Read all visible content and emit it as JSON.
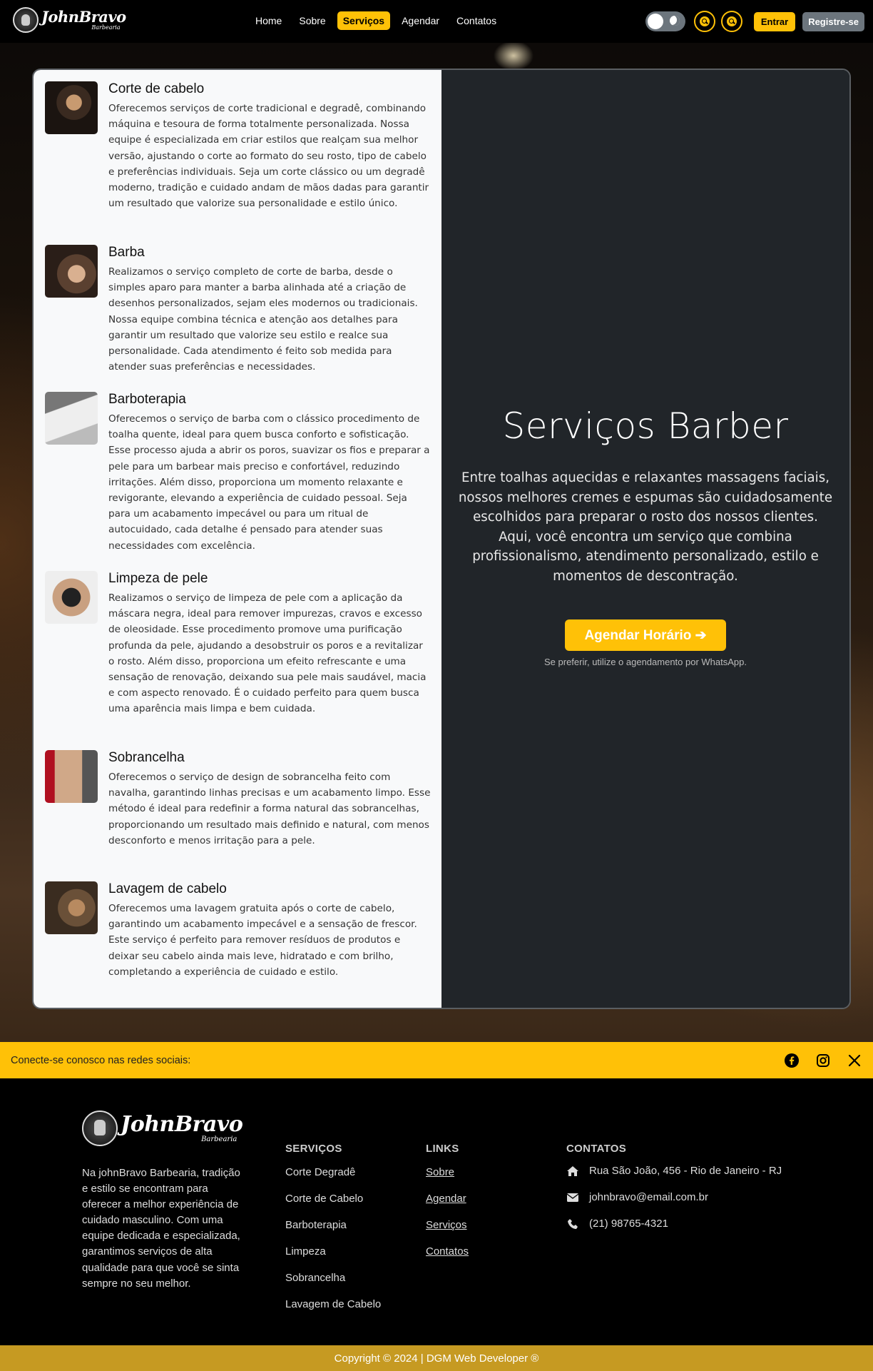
{
  "header": {
    "brand": "JohnBravo",
    "brand_sub": "Barbearia",
    "nav": [
      "Home",
      "Sobre",
      "Serviços",
      "Agendar",
      "Contatos"
    ],
    "active_nav": "Serviços",
    "login_label": "Entrar",
    "register_label": "Registre-se"
  },
  "services": [
    {
      "title": "Corte de cabelo",
      "description": "Oferecemos serviços de corte tradicional e degradê, combinando máquina e tesoura de forma totalmente personalizada. Nossa equipe é especializada em criar estilos que realçam sua melhor versão, ajustando o corte ao formato do seu rosto, tipo de cabelo e preferências individuais. Seja um corte clássico ou um degradê moderno, tradição e cuidado andam de mãos dadas para garantir um resultado que valorize sua personalidade e estilo único."
    },
    {
      "title": "Barba",
      "description": "Realizamos o serviço completo de corte de barba, desde o simples aparo para manter a barba alinhada até a criação de desenhos personalizados, sejam eles modernos ou tradicionais. Nossa equipe combina técnica e atenção aos detalhes para garantir um resultado que valorize seu estilo e realce sua personalidade. Cada atendimento é feito sob medida para atender suas preferências e necessidades."
    },
    {
      "title": "Barboterapia",
      "description": "Oferecemos o serviço de barba com o clássico procedimento de toalha quente, ideal para quem busca conforto e sofisticação. Esse processo ajuda a abrir os poros, suavizar os fios e preparar a pele para um barbear mais preciso e confortável, reduzindo irritações. Além disso, proporciona um momento relaxante e revigorante, elevando a experiência de cuidado pessoal. Seja para um acabamento impecável ou para um ritual de autocuidado, cada detalhe é pensado para atender suas necessidades com excelência."
    },
    {
      "title": "Limpeza de pele",
      "description": "Realizamos o serviço de limpeza de pele com a aplicação da máscara negra, ideal para remover impurezas, cravos e excesso de oleosidade. Esse procedimento promove uma purificação profunda da pele, ajudando a desobstruir os poros e a revitalizar o rosto. Além disso, proporciona um efeito refrescante e uma sensação de renovação, deixando sua pele mais saudável, macia e com aspecto renovado. É o cuidado perfeito para quem busca uma aparência mais limpa e bem cuidada."
    },
    {
      "title": "Sobrancelha",
      "description": "Oferecemos o serviço de design de sobrancelha feito com navalha, garantindo linhas precisas e um acabamento limpo. Esse método é ideal para redefinir a forma natural das sobrancelhas, proporcionando um resultado mais definido e natural, com menos desconforto e menos irritação para a pele."
    },
    {
      "title": "Lavagem de cabelo",
      "description": "Oferecemos uma lavagem gratuita após o corte de cabelo, garantindo um acabamento impecável e a sensação de frescor. Este serviço é perfeito para remover resíduos de produtos e deixar seu cabelo ainda mais leve, hidratado e com brilho, completando a experiência de cuidado e estilo."
    }
  ],
  "panel": {
    "title": "Serviços Barber",
    "text": "Entre toalhas aquecidas e relaxantes massagens faciais, nossos melhores cremes e espumas são cuidadosamente escolhidos para preparar o rosto dos nossos clientes. Aqui, você encontra um serviço que combina profissionalismo, atendimento personalizado, estilo e momentos de descontração.",
    "cta": "Agendar Horário ➔",
    "note": "Se preferir, utilize o agendamento por WhatsApp."
  },
  "social": {
    "text": "Conecte-se conosco nas redes sociais:",
    "icons": [
      "facebook-icon",
      "instagram-icon",
      "x-icon"
    ]
  },
  "footer": {
    "about": "Na johnBravo Barbearia, tradição e estilo se encontram para oferecer a melhor experiência de cuidado masculino. Com uma equipe dedicada e especializada, garantimos serviços de alta qualidade para que você se sinta sempre no seu melhor.",
    "services_head": "SERVIÇOS",
    "services": [
      "Corte Degradê",
      "Corte de Cabelo",
      "Barboterapia",
      "Limpeza",
      "Sobrancelha",
      "Lavagem de Cabelo"
    ],
    "links_head": "LINKS",
    "links": [
      "Sobre",
      "Agendar",
      "Serviços",
      "Contatos"
    ],
    "contacts_head": "CONTATOS",
    "address": "Rua São João, 456 - Rio de Janeiro - RJ",
    "email": "johnbravo@email.com.br",
    "phone": "(21) 98765-4321"
  },
  "copyright": "Copyright © 2024 | DGM Web Developer ®",
  "colors": {
    "accent": "#ffc107",
    "panel_bg": "#212529",
    "list_bg": "#f8f9fa",
    "copyright_bg": "#c69a22"
  }
}
